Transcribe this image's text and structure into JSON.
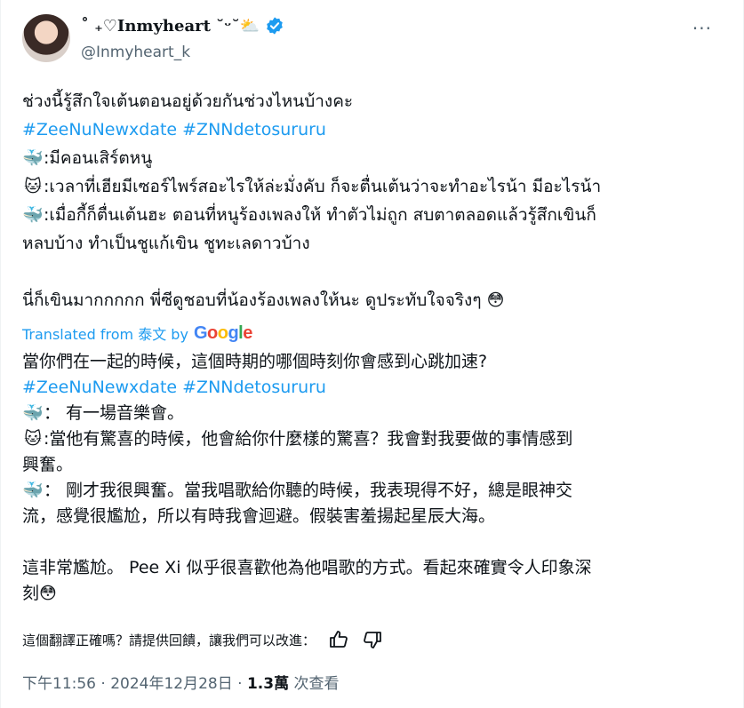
{
  "user": {
    "display_name": "˚ ₊♡Inmyheart ˘ᵕ˘⛅",
    "handle": "@Inmyheart_k",
    "verified_icon": "verified-badge-icon",
    "more_label": "···"
  },
  "original": {
    "line1": "ช่วงนี้รู้สึกใจเต้นตอนอยู่ด้วยกันช่วงไหนบ้างคะ",
    "hashtags": "#ZeeNuNewxdate #ZNNdetosururu",
    "lines": [
      {
        "emoji": "🐳",
        "text": ":มีคอนเสิร์ตหนู"
      },
      {
        "emoji": "🐱",
        "text": ":เวลาที่เฮียมีเซอร์ไพร์สอะไรให้ล่ะมั่งคับ ก็จะตื่นเต้นว่าจะทำอะไรน้า มีอะไรน้า"
      },
      {
        "emoji": "🐳",
        "text": ":เมื่อกี้ก็ตื่นเต้นฮะ ตอนที่หนูร้องเพลงให้ ทำตัวไม่ถูก สบตาตลอดแล้วรู้สึกเขินก็"
      },
      {
        "emoji": "",
        "text": "หลบบ้าง ทำเป็นชูแก้เขิน ชูทะเลดาวบ้าง"
      }
    ],
    "closing": "นี่ก็เขินมากกกกก พี่ซีดูชอบที่น้องร้องเพลงให้นะ ดูประทับใจจริงๆ 😳"
  },
  "translation": {
    "label": "Translated from 泰文 by",
    "google": [
      "G",
      "o",
      "o",
      "g",
      "l",
      "e"
    ],
    "line1": "當你們在一起的時候，這個時期的哪個時刻你會感到心跳加速?",
    "hashtags": "#ZeeNuNewxdate #ZNNdetosururu",
    "lines": [
      {
        "emoji": "🐳",
        "text": "： 有一場音樂會。"
      },
      {
        "emoji": "🐱",
        "text": ":當他有驚喜的時候，他會給你什麼樣的驚喜？我會對我要做的事情感到"
      },
      {
        "emoji": "",
        "text": "興奮。"
      },
      {
        "emoji": "🐳",
        "text": "： 剛才我很興奮。當我唱歌給你聽的時候，我表現得不好，總是眼神交"
      },
      {
        "emoji": "",
        "text": "流，感覺很尷尬，所以有時我會迴避。假裝害羞揚起星辰大海。"
      }
    ],
    "closing1": "這非常尷尬。 Pee Xi 似乎很喜歡他為他唱歌的方式。看起來確實令人印象深",
    "closing2": "刻😳"
  },
  "feedback": {
    "question": "這個翻譯正確嗎？請提供回饋，讓我們可以改進：",
    "thumbs_up_icon": "thumbs-up-icon",
    "thumbs_down_icon": "thumbs-down-icon"
  },
  "meta": {
    "time": "下午11:56 · 2024年12月28日 ·",
    "views_count": "1.3萬",
    "views_label": "次查看"
  }
}
